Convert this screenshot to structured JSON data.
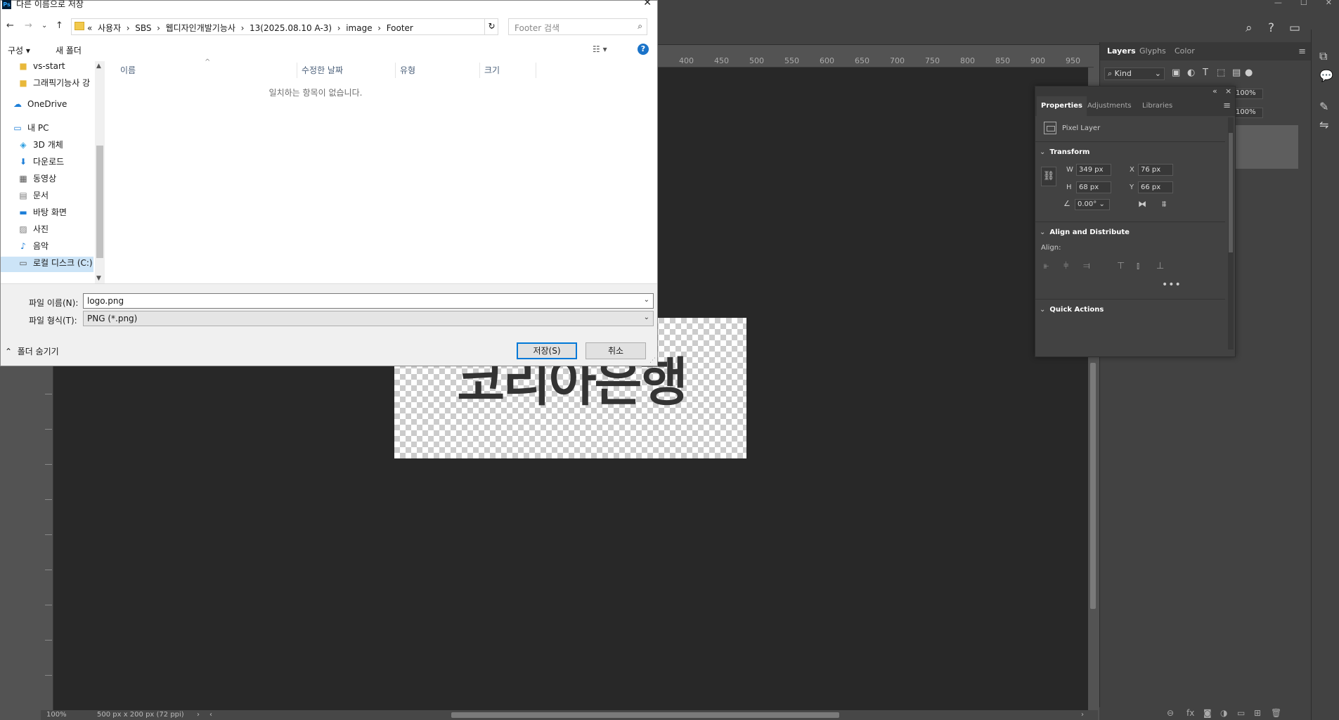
{
  "window": {
    "controls": [
      "—",
      "☐",
      "✕"
    ]
  },
  "photoshop": {
    "ruler_top_labels": [
      "400",
      "450",
      "500",
      "550",
      "600",
      "650",
      "700",
      "750",
      "800",
      "850",
      "900",
      "950"
    ],
    "logo_text": "코리아은행",
    "status": {
      "zoom": "100%",
      "doc_info": "500 px x 200 px (72 ppi)",
      "arrow": "›",
      "scroll_left": "‹",
      "scroll_right": "›"
    }
  },
  "layers_panel": {
    "tabs": [
      "Layers",
      "Glyphs",
      "Color"
    ],
    "kind_filter": "Kind",
    "opacity": "100%",
    "fill": "100%"
  },
  "properties_panel": {
    "tabs": [
      "Properties",
      "Adjustments",
      "Libraries"
    ],
    "layer_type": "Pixel Layer",
    "transform": {
      "title": "Transform",
      "w_label": "W",
      "w": "349 px",
      "h_label": "H",
      "h": "68 px",
      "x_label": "X",
      "x": "76 px",
      "y_label": "Y",
      "y": "66 px",
      "angle": "0.00°"
    },
    "align": {
      "title": "Align and Distribute",
      "label": "Align:",
      "more": "•••"
    },
    "quick_actions": {
      "title": "Quick Actions"
    }
  },
  "dialog": {
    "app_icon": "Ps",
    "title": "다른 이름으로 저장",
    "close": "✕",
    "address": {
      "prefix": "«",
      "crumbs": [
        "사용자",
        "SBS",
        "웹디자인개발기능사",
        "13(2025.08.10 A-3)",
        "image",
        "Footer"
      ],
      "separator": "›"
    },
    "search_placeholder": "Footer 검색",
    "toolbar": {
      "organize": "구성 ▾",
      "new_folder": "새 폴더",
      "help": "?"
    },
    "nav_items": [
      {
        "label": "vs-start",
        "icon": "folder-icon"
      },
      {
        "label": "그래픽기능사 강",
        "icon": "folder-icon"
      },
      {
        "label": "OneDrive",
        "icon": "cloud-icon"
      },
      {
        "label": "내 PC",
        "icon": "computer-icon"
      },
      {
        "label": "3D 개체",
        "icon": "cube-icon"
      },
      {
        "label": "다운로드",
        "icon": "download-icon"
      },
      {
        "label": "동영상",
        "icon": "video-icon"
      },
      {
        "label": "문서",
        "icon": "document-icon"
      },
      {
        "label": "바탕 화면",
        "icon": "desktop-icon"
      },
      {
        "label": "사진",
        "icon": "picture-icon"
      },
      {
        "label": "음악",
        "icon": "music-icon"
      },
      {
        "label": "로컬 디스크 (C:)",
        "icon": "disk-icon"
      }
    ],
    "columns": [
      "이름",
      "수정한 날짜",
      "유형",
      "크기"
    ],
    "empty_message": "일치하는 항목이 없습니다.",
    "file_name_label": "파일 이름(N):",
    "file_name": "logo.png",
    "file_type_label": "파일 형식(T):",
    "file_type": "PNG (*.png)",
    "hide_folders": "폴더 숨기기",
    "save_button": "저장(S)",
    "cancel_button": "취소"
  }
}
